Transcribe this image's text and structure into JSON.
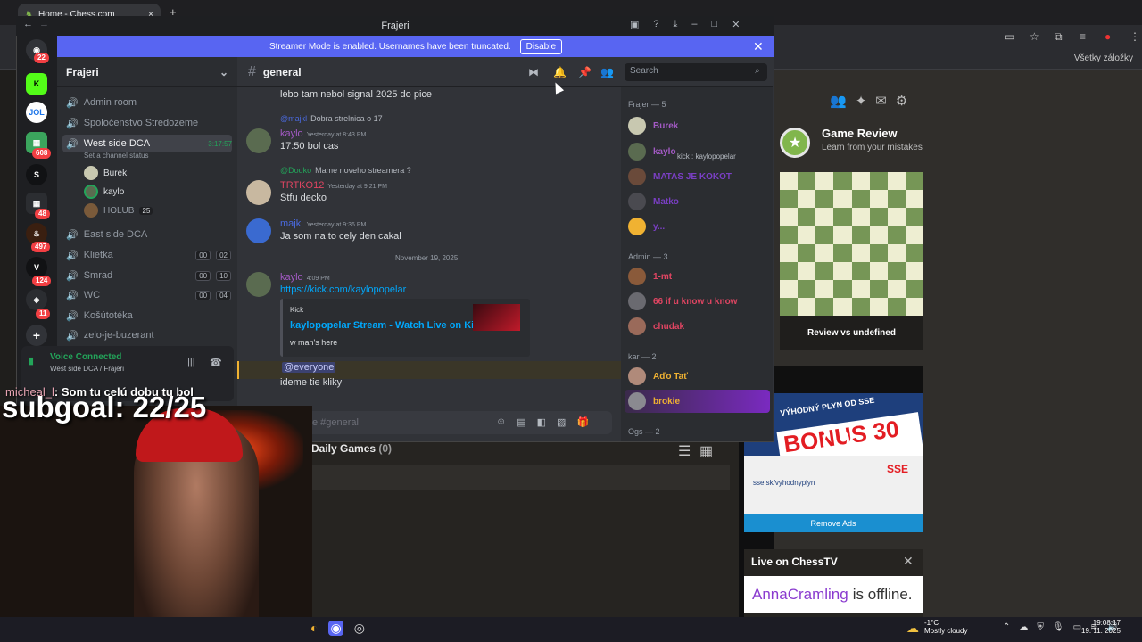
{
  "browser": {
    "tab_title": "Home - Chess.com",
    "bookmarks_label": "Všetky záložky"
  },
  "discord": {
    "window_title": "Frajeri",
    "banner_text": "Streamer Mode is enabled. Usernames have been truncated.",
    "banner_button": "Disable",
    "server_name": "Frajeri",
    "guild_badges": [
      "22",
      "608",
      "48",
      "497",
      "124",
      "11"
    ],
    "channels": [
      {
        "name": "Admin room",
        "type": "voice"
      },
      {
        "name": "Spoločenstvo Stredozeme",
        "type": "voice"
      },
      {
        "name": "West side DCA",
        "type": "voice",
        "timer": "3:17:57",
        "status": "Set a channel status"
      },
      {
        "name": "East side DCA",
        "type": "voice"
      },
      {
        "name": "Klietka",
        "type": "voice",
        "counts": [
          "00",
          "02"
        ]
      },
      {
        "name": "Smrad",
        "type": "voice",
        "counts": [
          "00",
          "10"
        ]
      },
      {
        "name": "WC",
        "type": "voice",
        "counts": [
          "00",
          "04"
        ]
      },
      {
        "name": "Košútotéka",
        "type": "voice"
      },
      {
        "name": "zelo-je-buzerant",
        "type": "voice"
      }
    ],
    "voice_users": [
      "Burek",
      "kaylo",
      "HOLUB",
      "25"
    ],
    "voice_connected": {
      "title": "Voice Connected",
      "sub": "West side DCA / Frajeri"
    },
    "channel_header": "general",
    "search_placeholder": "Search",
    "messages": [
      {
        "text": "lebo tam nebol signal 2025 do pice"
      },
      {
        "reply_user": "@majkl",
        "reply_text": "Dobra strelnica o 17",
        "author": "kaylo",
        "author_color": "#a35ac4",
        "time": "Yesterday at 8:43 PM",
        "text": "17:50 bol cas"
      },
      {
        "reply_user": "@Dodko",
        "reply_text": "Mame noveho streamera ?",
        "author": "TRTKO12",
        "author_color": "#e04562",
        "time": "Yesterday at 9:21 PM",
        "text": "Stfu decko"
      },
      {
        "author": "majkl",
        "author_color": "#4a6ae0",
        "time": "Yesterday at 9:36 PM",
        "text": "Ja som na to cely den cakal"
      },
      {
        "author": "kaylo",
        "author_color": "#a35ac4",
        "time": "4:09 PM",
        "text": "https://kick.com/kaylopopelar"
      }
    ],
    "date_divider": "November 19, 2025",
    "embed": {
      "provider": "Kick",
      "title": "kaylopopelar Stream - Watch Live on Kick",
      "desc": "w man's here"
    },
    "mention": "@everyone",
    "last_message": "ideme tie kliky",
    "composer_placeholder": "e #general",
    "member_groups": [
      {
        "header": "Frajer — 5",
        "members": [
          {
            "name": "Burek",
            "color": "#a35ac4",
            "sub": ""
          },
          {
            "name": "kaylo",
            "color": "#a35ac4",
            "sub": "kick : kaylopopelar"
          },
          {
            "name": "MATAS JE KOKOT",
            "color": "#7a3fc4"
          },
          {
            "name": "Matko",
            "color": "#7a3fc4"
          },
          {
            "name": "y...",
            "color": "#7a3fc4"
          }
        ]
      },
      {
        "header": "Admin — 3",
        "members": [
          {
            "name": "1-mt",
            "color": "#e04562"
          },
          {
            "name": "66 if u know u know",
            "color": "#e04562"
          },
          {
            "name": "chudak",
            "color": "#e04562"
          }
        ]
      },
      {
        "header": "kar — 2",
        "members": [
          {
            "name": "Aďo Tať",
            "color": "#f0b232"
          },
          {
            "name": "brokie",
            "color": "#f0b232"
          }
        ]
      },
      {
        "header": "Ogs — 2",
        "members": []
      }
    ]
  },
  "chess": {
    "game_review_title": "Game Review",
    "game_review_sub": "Learn from your mistakes",
    "review_button": "Review vs undefined",
    "daily_games_label": "Daily Games",
    "daily_games_count": "(0)",
    "ad_title": "VÝHODNÝ PLYN OD SSE",
    "ad_bonus": "BONUS 30 €",
    "ad_url": "sse.sk/vyhodnyplyn",
    "ad_logo": "SSE",
    "remove_ads": "Remove Ads",
    "live_title": "Live on ChessTV",
    "live_user": "AnnaCramling",
    "live_status": "is offline."
  },
  "stream": {
    "chat_user": "micheal_l",
    "chat_text": ": Som tu celú dobu tu bol",
    "subgoal": "subgoal: 22/25"
  },
  "taskbar": {
    "temp": "-1°C",
    "weather": "Mostly cloudy",
    "time": "19:08:17",
    "date": "19. 11. 2025"
  }
}
